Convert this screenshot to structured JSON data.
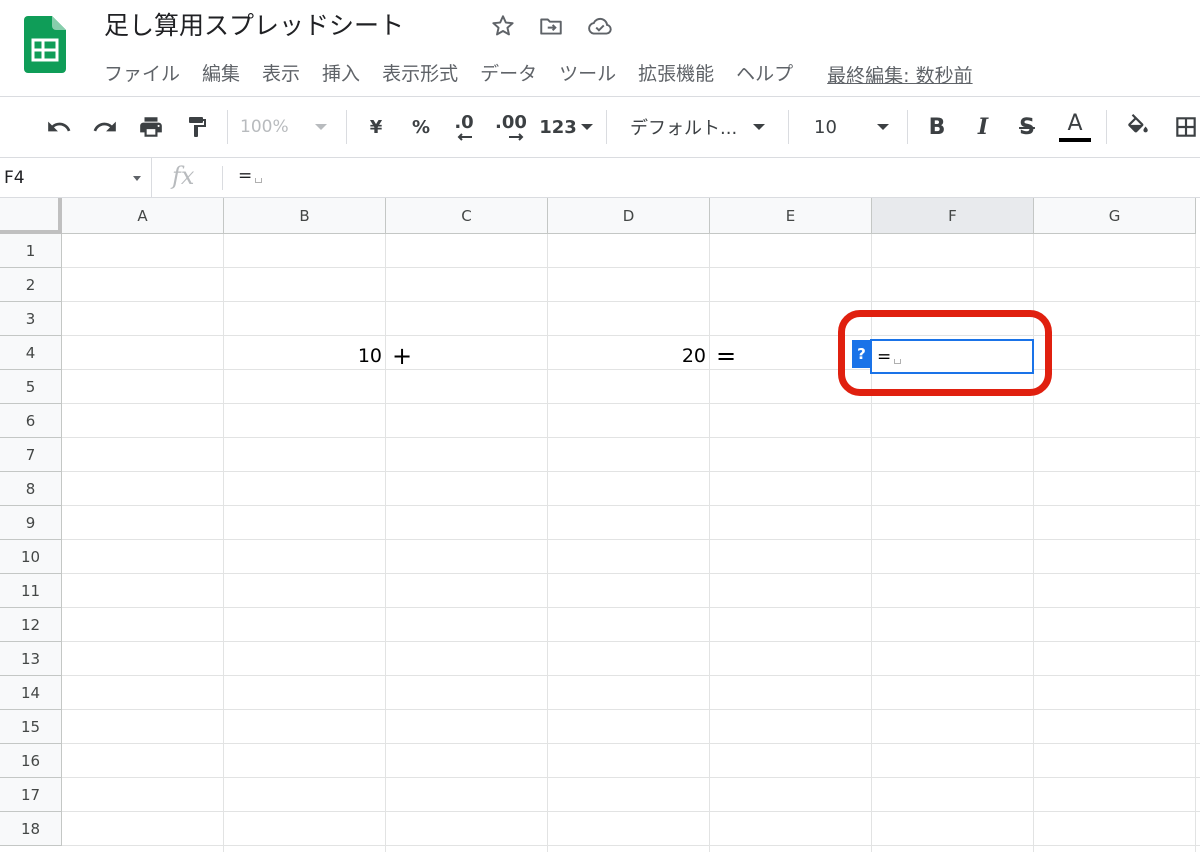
{
  "document": {
    "title": "足し算用スプレッドシート"
  },
  "menu": {
    "items": [
      "ファイル",
      "編集",
      "表示",
      "挿入",
      "表示形式",
      "データ",
      "ツール",
      "拡張機能",
      "ヘルプ"
    ],
    "last_edit": "最終編集: 数秒前"
  },
  "toolbar": {
    "zoom": "100%",
    "currency": "¥",
    "percent": "%",
    "decrease_decimal": ".0",
    "increase_decimal": ".00",
    "number_format": "123",
    "font": "デフォルト...",
    "font_size": "10",
    "bold": "B",
    "italic": "I",
    "strikethrough": "S",
    "text_color": "A",
    "text_color_value": "#000000"
  },
  "formula_bar": {
    "name_box": "F4",
    "fx": "fx",
    "value": "="
  },
  "grid": {
    "columns": [
      "A",
      "B",
      "C",
      "D",
      "E",
      "F",
      "G"
    ],
    "active_column": "F",
    "rows": [
      "1",
      "2",
      "3",
      "4",
      "5",
      "6",
      "7",
      "8",
      "9",
      "10",
      "11",
      "12",
      "13",
      "14",
      "15",
      "16",
      "17",
      "18"
    ],
    "cells": {
      "B4": "10",
      "C4": "+",
      "D4": "20",
      "E4": "=",
      "F4": "="
    },
    "help_badge": "?"
  },
  "colors": {
    "accent": "#1a73e8",
    "highlight": "#e0200f",
    "sheets_green": "#0f9d58"
  }
}
